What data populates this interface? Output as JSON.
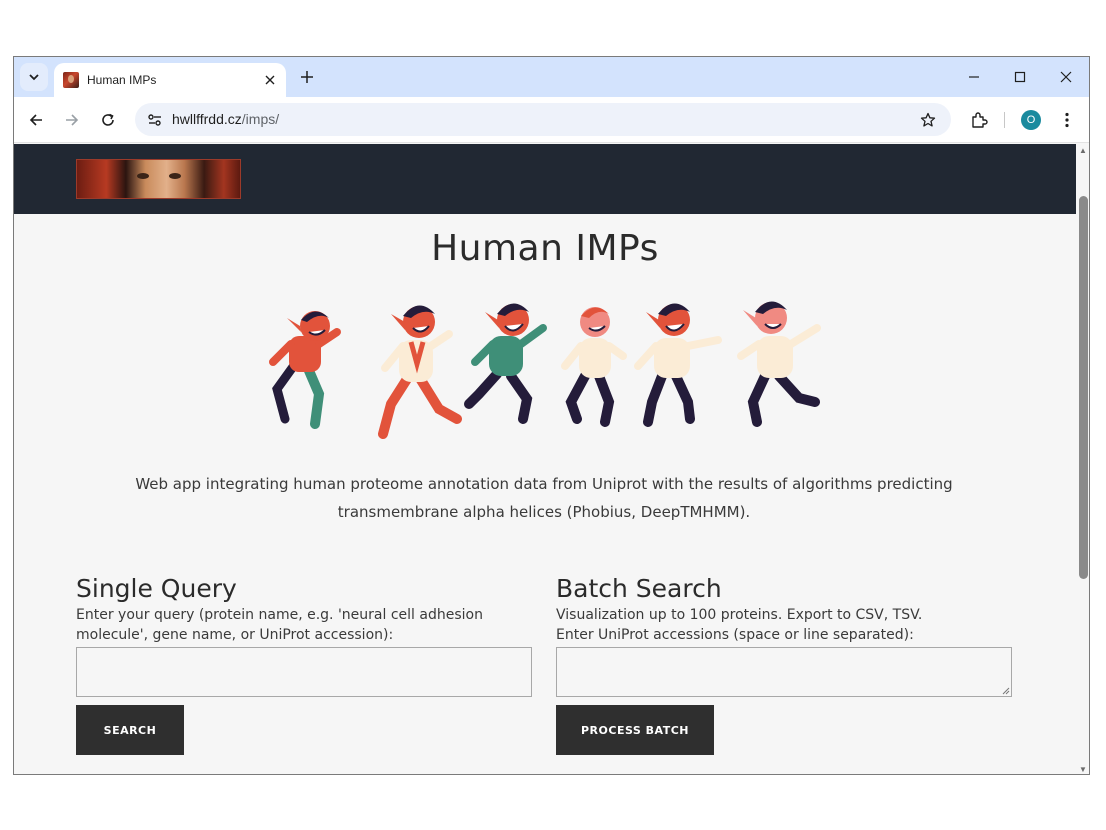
{
  "browser": {
    "tab_title": "Human IMPs",
    "url_host": "hwllffrdd.cz",
    "url_path": "/imps/",
    "profile_initial": "O",
    "icons": [
      "tab-search-icon",
      "close-icon",
      "plus-icon",
      "minimize-icon",
      "maximize-icon",
      "window-close-icon",
      "back-arrow-icon",
      "forward-arrow-icon",
      "reload-icon",
      "site-info-icon",
      "star-icon",
      "extensions-icon",
      "kebab-menu-icon"
    ]
  },
  "page": {
    "title": "Human IMPs",
    "intro_line1": "Web app integrating human proteome annotation data from Uniprot with the results of algorithms predicting",
    "intro_line2": "transmembrane alpha helices (Phobius, DeepTMHMM).",
    "single_query": {
      "heading": "Single Query",
      "description": "Enter your query (protein name, e.g. 'neural cell adhesion molecule', gene name, or UniProt accession):",
      "input_value": "",
      "button_label": "SEARCH"
    },
    "batch_search": {
      "heading": "Batch Search",
      "line1": "Visualization up to 100 proteins. Export to CSV, TSV.",
      "line2": "Enter UniProt accessions (space or line separated):",
      "input_value": "",
      "button_label": "PROCESS BATCH"
    }
  },
  "colors": {
    "header_bg": "#212833",
    "page_bg": "#f6f6f6",
    "button_bg": "#2f2f2f",
    "tabstrip_bg": "#d3e3fd",
    "imp_red": "#e2533b",
    "imp_navy": "#241c3a",
    "imp_green": "#3f8f78",
    "imp_cream": "#fbecd6"
  }
}
